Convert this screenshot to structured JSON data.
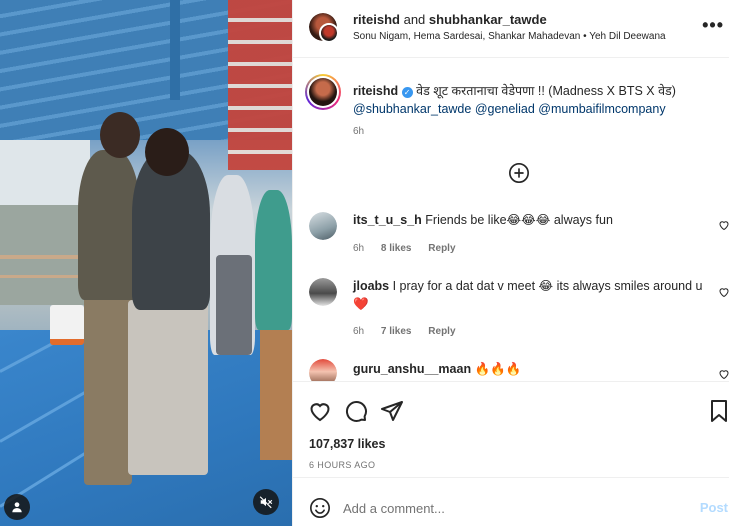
{
  "post": {
    "author": "riteishd",
    "connector": "and",
    "collaborator": "shubhankar_tawde",
    "audio": "Sonu Nigam, Hema Sardesai, Shankar Mahadevan • Yeh Dil Deewana",
    "more_label": "•••"
  },
  "caption": {
    "user": "riteishd",
    "text": "वेड शूट करतानाचा वेडेपणा !! (Madness X BTS X वेड)",
    "mentions": [
      "@shubhankar_tawde",
      "@geneliad",
      "@mumbaifilmcompany"
    ],
    "age": "6h"
  },
  "comments": [
    {
      "user": "its_t_u_s_h",
      "text": "Friends be like😂😂😂 always fun",
      "age": "6h",
      "likes": "8 likes",
      "reply": "Reply"
    },
    {
      "user": "jloabs",
      "text": "I pray for a dat dat v meet 😂 its always smiles around u",
      "text2": "❤️",
      "age": "6h",
      "likes": "7 likes",
      "reply": "Reply"
    },
    {
      "user": "guru_anshu__maan",
      "text": "🔥🔥🔥"
    }
  ],
  "stats": {
    "likes": "107,837 likes",
    "time": "6 HOURS AGO"
  },
  "composer": {
    "placeholder": "Add a comment...",
    "post_label": "Post"
  },
  "icons": {
    "like": "heart-icon",
    "comment": "comment-icon",
    "share": "share-icon",
    "save": "bookmark-icon",
    "emoji": "emoji-icon",
    "load_more": "plus-circle-icon",
    "mute": "speaker-muted-icon",
    "tags": "user-tag-icon"
  },
  "colors": {
    "link": "#00376b",
    "verified": "#3897f0",
    "secondary_text": "#737373",
    "post_disabled": "#b3dbff",
    "heart_red": "#ed4956"
  }
}
